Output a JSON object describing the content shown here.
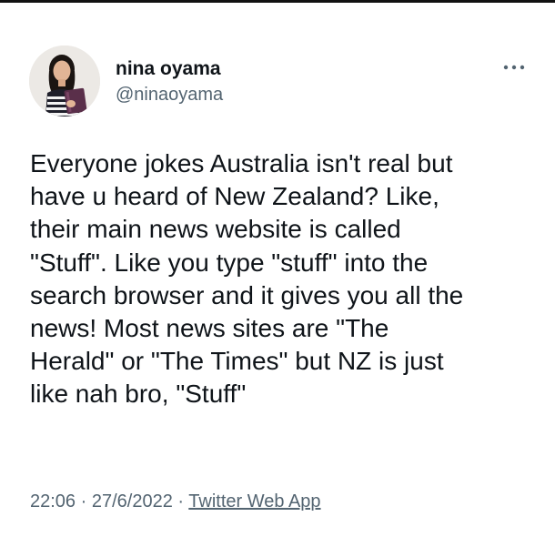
{
  "author": {
    "display_name": "nina oyama",
    "handle": "@ninaoyama"
  },
  "icons": {
    "more": "more-horizontal-icon",
    "avatar": "profile-photo"
  },
  "tweet": {
    "text": "Everyone jokes Australia isn't real but\nhave u heard of New Zealand? Like,\ntheir main news website is called\n\"Stuff\". Like you type \"stuff\" into the\nsearch browser and it gives you all the\nnews! Most news sites are \"The\nHerald\" or \"The Times\" but NZ is just\nlike nah bro, \"Stuff\""
  },
  "meta": {
    "time": "22:06",
    "separator": "·",
    "date": "27/6/2022",
    "source": "Twitter Web App"
  },
  "colors": {
    "text_primary": "#0f1419",
    "text_secondary": "#536471",
    "background": "#ffffff"
  }
}
